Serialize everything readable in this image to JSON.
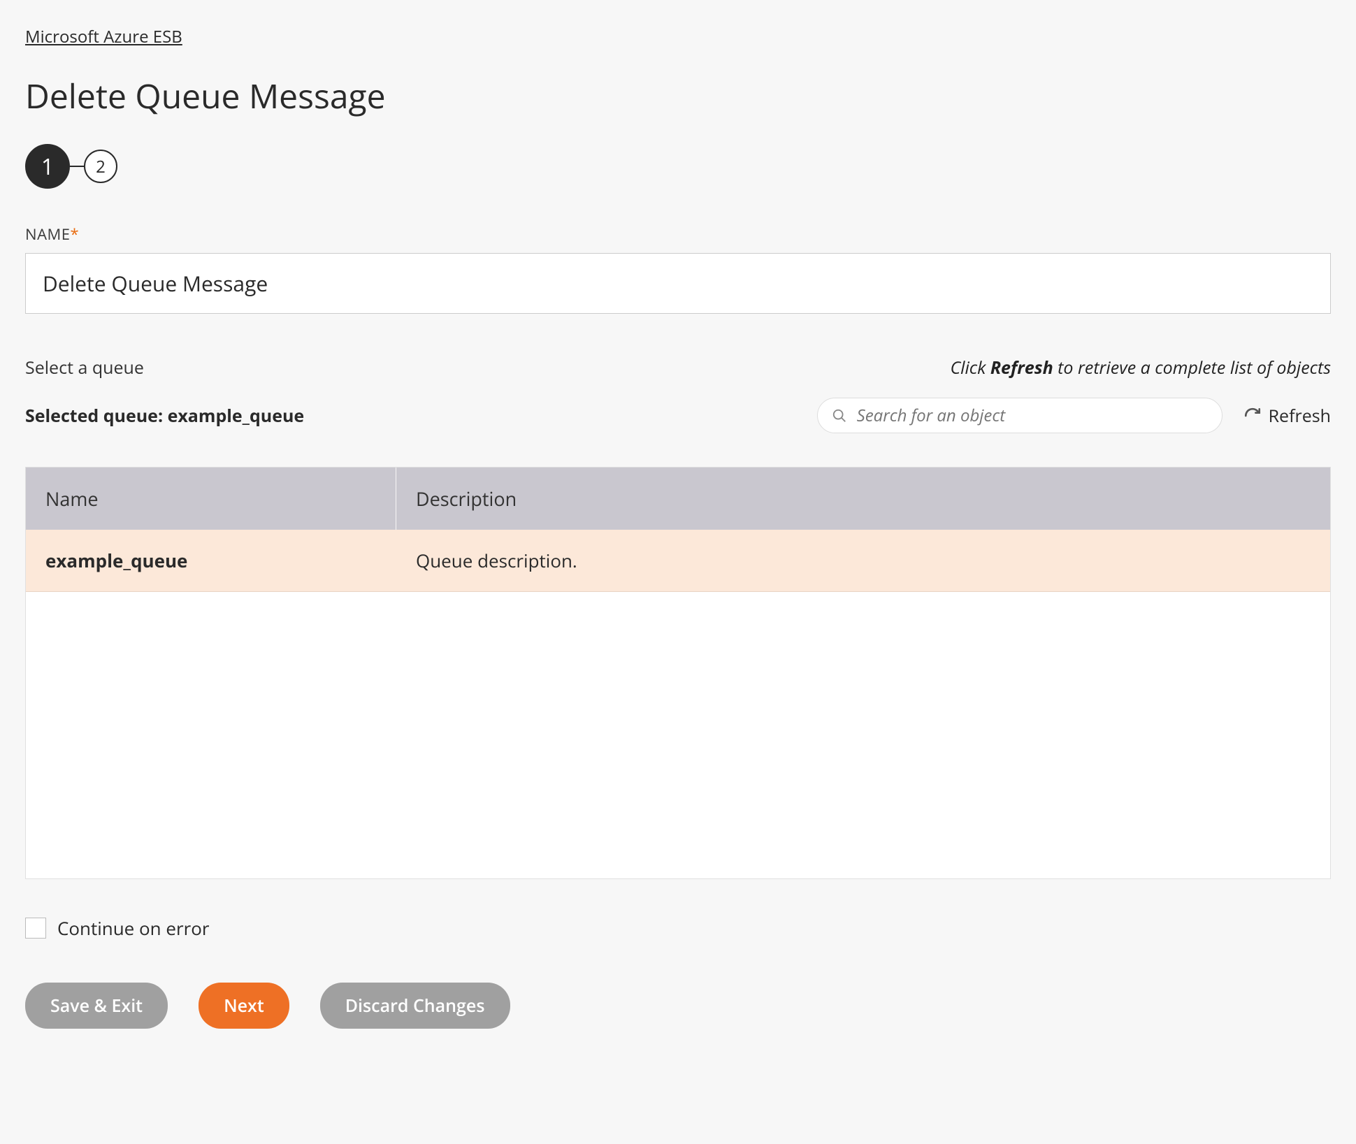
{
  "breadcrumb": {
    "label": "Microsoft Azure ESB"
  },
  "page": {
    "title": "Delete Queue Message"
  },
  "stepper": {
    "steps": [
      "1",
      "2"
    ],
    "active_index": 0
  },
  "fields": {
    "name_label": "NAME",
    "name_value": "Delete Queue Message"
  },
  "queue_select": {
    "label": "Select a queue",
    "hint_prefix": "Click ",
    "hint_bold": "Refresh",
    "hint_suffix": " to retrieve a complete list of objects",
    "selected_prefix": "Selected queue: ",
    "selected_value": "example_queue",
    "search_placeholder": "Search for an object",
    "refresh_label": "Refresh"
  },
  "table": {
    "columns": {
      "name": "Name",
      "description": "Description"
    },
    "rows": [
      {
        "name": "example_queue",
        "description": "Queue description."
      }
    ]
  },
  "options": {
    "continue_on_error_label": "Continue on error",
    "continue_on_error_checked": false
  },
  "buttons": {
    "save_exit": "Save & Exit",
    "next": "Next",
    "discard": "Discard Changes"
  }
}
